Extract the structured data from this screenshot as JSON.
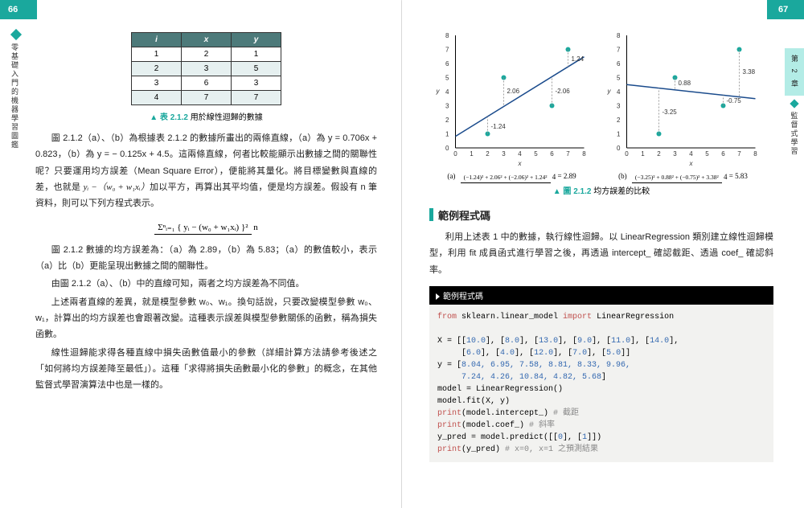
{
  "page_left_num": "66",
  "page_right_num": "67",
  "side_left_label": "零基礎入門的機器學習圖鑑",
  "side_right_chapter": "第 2 章",
  "side_right_label": "監督式學習",
  "table": {
    "headers": [
      "i",
      "x",
      "y"
    ],
    "rows": [
      [
        "1",
        "2",
        "1"
      ],
      [
        "2",
        "3",
        "5"
      ],
      [
        "3",
        "6",
        "3"
      ],
      [
        "4",
        "7",
        "7"
      ]
    ],
    "caption_tag": "▲ 表 2.1.2",
    "caption_text": "用於線性迴歸的數據"
  },
  "left_para1_a": "圖 2.1.2（a）、（b）為根據表 2.1.2 的數據所畫出的兩條直線，（a）為 y = 0.706x + 0.823，（b）為 y = − 0.125x + 4.5。這兩條直線，何者比較能顯示出數據之間的關聯性呢？只要運用均方誤差（Mean Square Error），便能將其量化。將目標變數與直線的差，也就是 ",
  "left_para1_math": "yᵢ −（w₀ + w₁xᵢ）",
  "left_para1_b": "加以平方，再算出其平均值，便是均方誤差。假設有 n 筆資料，則可以下列方程式表示。",
  "formula": {
    "numerator": "Σⁿᵢ₌₁ { yᵢ − (w₀ + w₁xᵢ) }²",
    "denominator": "n"
  },
  "left_para2": "圖 2.1.2 數據的均方誤差為：（a）為 2.89，（b）為 5.83；（a）的數值較小，表示（a）比（b）更能呈現出數據之間的關聯性。",
  "left_para3": "由圖 2.1.2（a）、（b）中的直線可知，兩者之均方誤差為不同值。",
  "left_para4": "上述兩者直線的差異，就是模型參數 w₀、w₁。換句話說，只要改變模型參數 w₀、w₁，計算出的均方誤差也會跟著改變。這種表示誤差與模型參數關係的函數，稱為損失函數。",
  "left_para5": "線性迴歸能求得各種直線中損失函數值最小的參數（詳細計算方法請參考後述之「如何將均方誤差降至最低」）。這種「求得將損失函數最小化的參數」的概念，在其他監督式學習演算法中也是一樣的。",
  "chart_data": [
    {
      "type": "scatter-with-line",
      "label": "(a)",
      "xlabel": "x",
      "ylabel": "y",
      "xlim": [
        0,
        8
      ],
      "ylim": [
        0,
        8
      ],
      "points": [
        [
          2,
          1
        ],
        [
          3,
          5
        ],
        [
          6,
          3
        ],
        [
          7,
          7
        ]
      ],
      "line": {
        "slope": 0.706,
        "intercept": 0.823
      },
      "residual_labels": [
        "-1.24",
        "2.06",
        "-2.06",
        "1.24"
      ],
      "equation_num": "(−1.24)² + 2.06² + (−2.06)² + 1.24²",
      "equation_den": "4",
      "equation_result": "= 2.89"
    },
    {
      "type": "scatter-with-line",
      "label": "(b)",
      "xlabel": "x",
      "ylabel": "y",
      "xlim": [
        0,
        8
      ],
      "ylim": [
        0,
        8
      ],
      "points": [
        [
          2,
          1
        ],
        [
          3,
          5
        ],
        [
          6,
          3
        ],
        [
          7,
          7
        ]
      ],
      "line": {
        "slope": -0.125,
        "intercept": 4.5
      },
      "residual_labels": [
        "-3.25",
        "0.88",
        "-0.75",
        "3.38"
      ],
      "equation_num": "(−3.25)² + 0.88² + (−0.75)² + 3.38²",
      "equation_den": "4",
      "equation_result": "= 5.83"
    }
  ],
  "chart_caption_tag": "▲ 圖 2.1.2",
  "chart_caption_text": "均方誤差的比較",
  "section_heading": "範例程式碼",
  "right_para": "利用上述表 1 中的數據，執行線性迴歸。以 LinearRegression 類別建立線性迴歸模型，利用 fit 成員函式進行學習之後，再透過 intercept_ 確認截距、透過 coef_ 確認斜率。",
  "code": {
    "title": "範例程式碼",
    "l1a": "from",
    "l1b": " sklearn.linear_model ",
    "l1c": "import",
    "l1d": " LinearRegression",
    "l2": "",
    "l3a": "X = [[",
    "l3b": "10.0",
    "l3c": "], [",
    "l3d": "8.0",
    "l3e": "], [",
    "l3f": "13.0",
    "l3g": "], [",
    "l3h": "9.0",
    "l3i": "], [",
    "l3j": "11.0",
    "l3k": "], [",
    "l3l": "14.0",
    "l3m": "],",
    "l4a": "     [",
    "l4b": "6.0",
    "l4c": "], [",
    "l4d": "4.0",
    "l4e": "], [",
    "l4f": "12.0",
    "l4g": "], [",
    "l4h": "7.0",
    "l4i": "], [",
    "l4j": "5.0",
    "l4k": "]]",
    "l5a": "y = [",
    "l5_vals": "8.04, 6.95, 7.58, 8.81, 8.33, 9.96,",
    "l6_vals": "     7.24, 4.26, 10.84, 4.82, 5.68",
    "l6b": "]",
    "l7": "model = LinearRegression()",
    "l8": "model.fit(X, y)",
    "l9a": "print",
    "l9b": "(model.intercept_) ",
    "l9c": "# 截距",
    "l10a": "print",
    "l10b": "(model.coef_) ",
    "l10c": "# 斜率",
    "l11": "y_pred = model.predict([[",
    "l11b": "0",
    "l11c": "], [",
    "l11d": "1",
    "l11e": "]])",
    "l12a": "print",
    "l12b": "(y_pred) ",
    "l12c": "# x=0, x=1 之預測結果"
  }
}
